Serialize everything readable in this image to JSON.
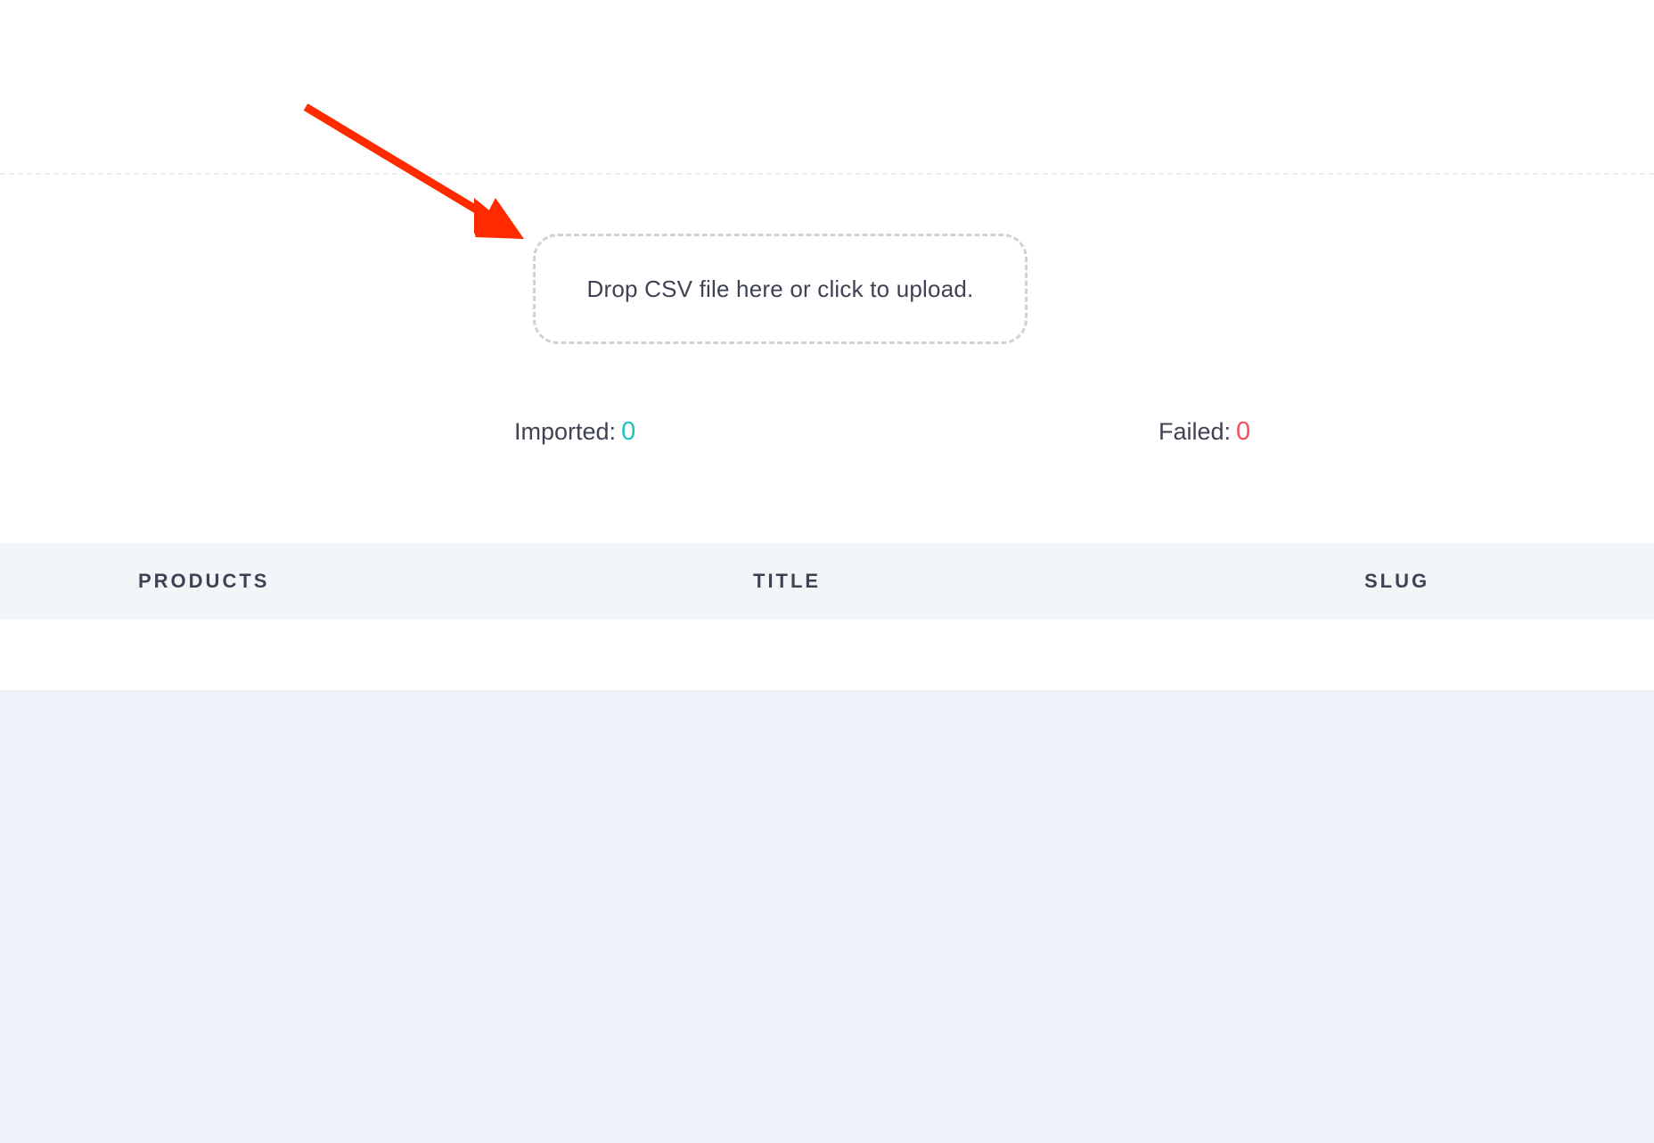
{
  "upload": {
    "dropzone_text": "Drop CSV file here or click to upload."
  },
  "stats": {
    "imported_label": "Imported:",
    "imported_value": "0",
    "failed_label": "Failed:",
    "failed_value": "0"
  },
  "table": {
    "columns": [
      "PRODUCTS",
      "TITLE",
      "SLUG"
    ],
    "rows": []
  },
  "colors": {
    "arrow": "#ff2a00",
    "imported_value": "#1bc5bd",
    "failed_value": "#f64e60",
    "page_background": "#eef1f8",
    "table_header_background": "#f3f6f9"
  }
}
